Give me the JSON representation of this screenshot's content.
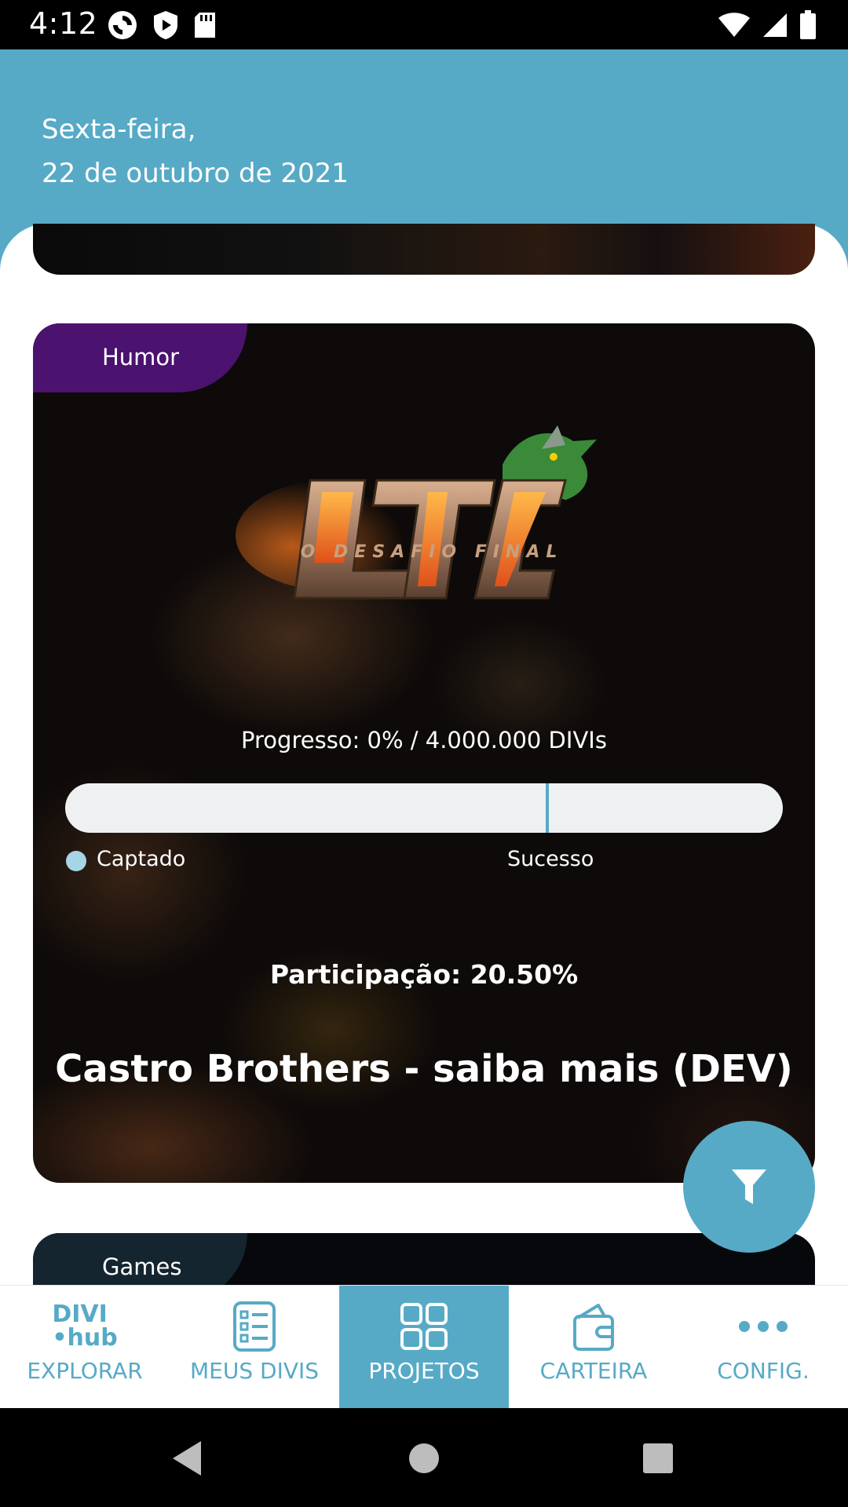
{
  "status_bar": {
    "time": "4:12"
  },
  "header": {
    "date_line1": "Sexta-feira,",
    "date_line2": "22 de outubro de 2021"
  },
  "card": {
    "category": "Humor",
    "logo_text": "LTC",
    "logo_subtitle": "O DESAFIO FINAL",
    "progress_text": "Progresso: 0% / 4.000.000 DIVIs",
    "progress_fraction": 0,
    "success_fraction": 0.67,
    "legend_captado": "Captado",
    "legend_sucesso": "Sucesso",
    "participation": "Participação: 20.50%",
    "title": "Castro Brothers - saiba mais (DEV)"
  },
  "next_card": {
    "category": "Games"
  },
  "fab": {
    "icon": "filter-icon"
  },
  "bottom_nav": {
    "items": [
      {
        "label": "EXPLORAR",
        "icon": "divi-hub-logo",
        "logo_line1": "DIVI",
        "logo_line2": "•hub",
        "active": false
      },
      {
        "label": "MEUS DIVIS",
        "icon": "list-icon",
        "active": false
      },
      {
        "label": "PROJETOS",
        "icon": "grid-icon",
        "active": true
      },
      {
        "label": "CARTEIRA",
        "icon": "wallet-icon",
        "active": false
      },
      {
        "label": "CONFIG.",
        "icon": "more-icon",
        "active": false
      }
    ]
  },
  "colors": {
    "accent": "#56aac6",
    "humor_tag": "#4b1270",
    "games_tag": "#15252f"
  }
}
